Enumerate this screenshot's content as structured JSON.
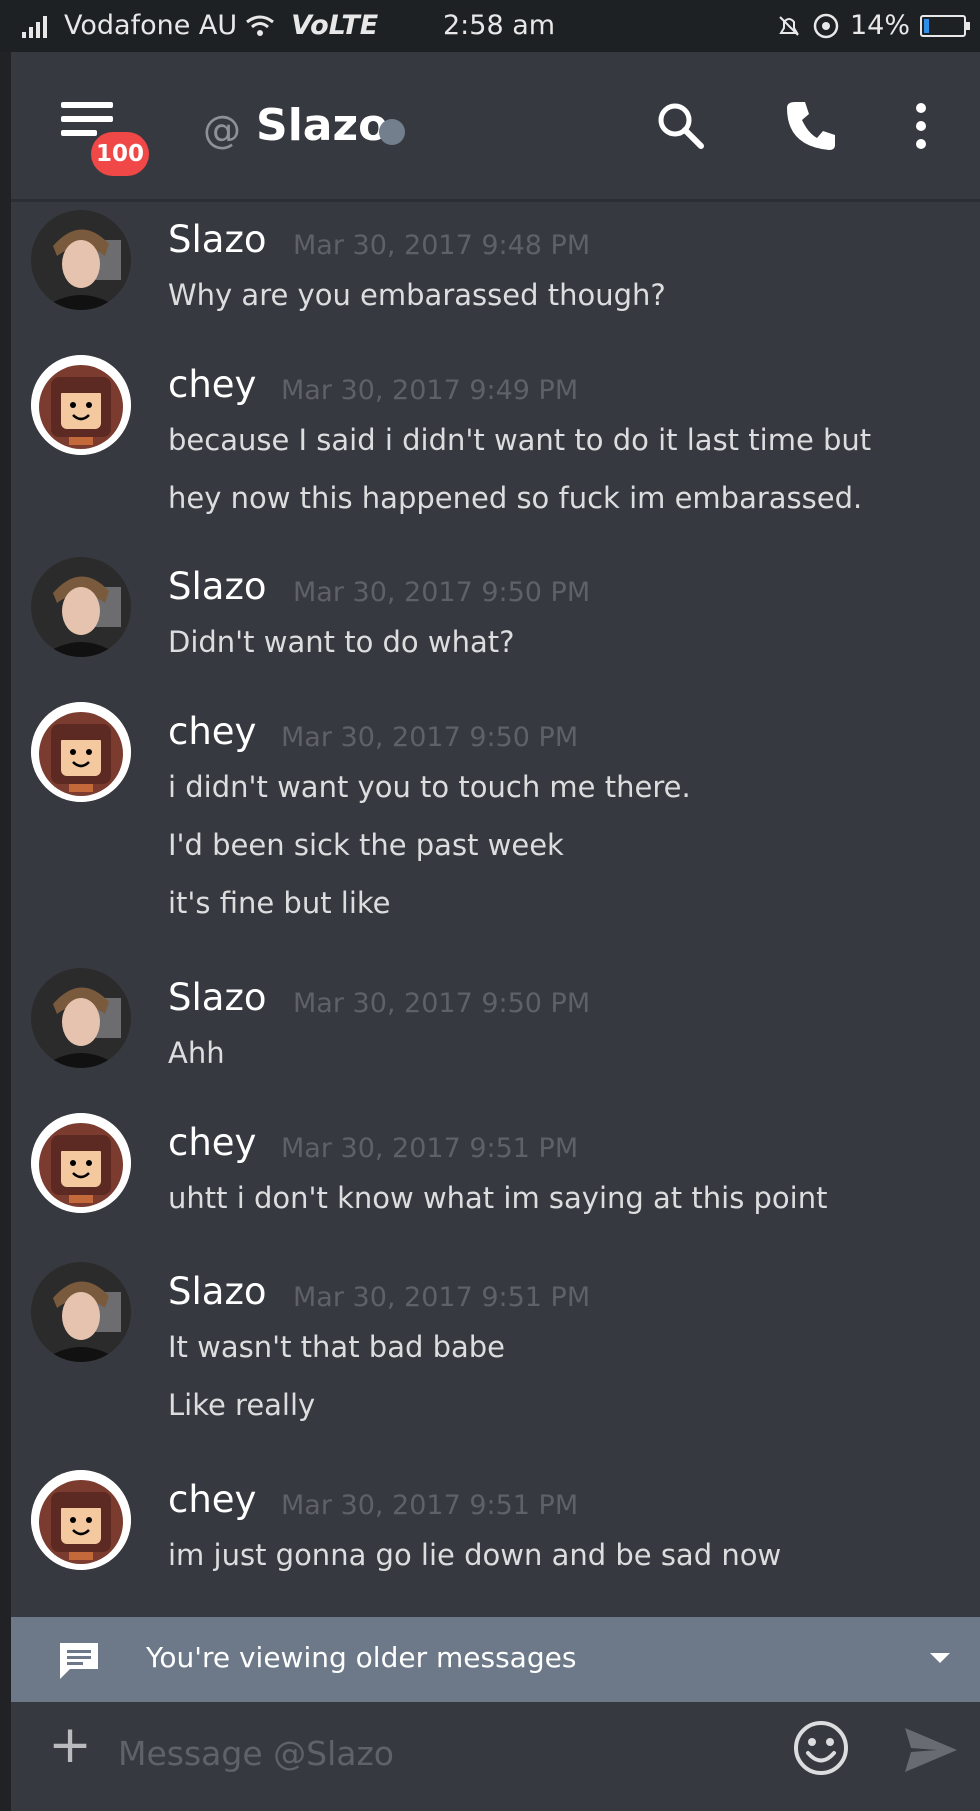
{
  "status_bar": {
    "carrier": "Vodafone AU",
    "network": "VoLTE",
    "time": "2:58 am",
    "battery": "14%",
    "battery_level": 0.14
  },
  "header": {
    "at_symbol": "@",
    "channel_name": "Slazo",
    "badge_count": "100",
    "status_color": "#747f8d",
    "icons": [
      "menu-icon",
      "search-icon",
      "phone-icon",
      "more-vertical-icon"
    ]
  },
  "messages": [
    {
      "author": "Slazo",
      "timestamp": "Mar 30, 2017 9:48 PM",
      "lines": [
        "Why are you embarassed though?"
      ]
    },
    {
      "author": "chey",
      "timestamp": "Mar 30, 2017 9:49 PM",
      "lines": [
        "because I said i didn't want to do it last time but",
        "hey now this happened so fuck im embarassed."
      ]
    },
    {
      "author": "Slazo",
      "timestamp": "Mar 30, 2017 9:50 PM",
      "lines": [
        "Didn't want to do what?"
      ]
    },
    {
      "author": "chey",
      "timestamp": "Mar 30, 2017 9:50 PM",
      "lines": [
        "i didn't want you to touch me there.",
        "I'd been sick the past week",
        "it's fine but like"
      ]
    },
    {
      "author": "Slazo",
      "timestamp": "Mar 30, 2017 9:50 PM",
      "lines": [
        "Ahh"
      ]
    },
    {
      "author": "chey",
      "timestamp": "Mar 30, 2017 9:51 PM",
      "lines": [
        "uhtt i don't know what im saying at this point"
      ]
    },
    {
      "author": "Slazo",
      "timestamp": "Mar 30, 2017 9:51 PM",
      "lines": [
        "It wasn't that bad babe",
        "Like really"
      ]
    },
    {
      "author": "chey",
      "timestamp": "Mar 30, 2017 9:51 PM",
      "lines": [
        "im just gonna go lie down and be sad now"
      ]
    }
  ],
  "older_banner": {
    "text": "You're viewing older messages"
  },
  "composer": {
    "placeholder": "Message @Slazo"
  },
  "colors": {
    "background": "#36393f",
    "badge": "#f04747",
    "banner": "#6d7989",
    "battery_fill": "#2f8fe8"
  }
}
